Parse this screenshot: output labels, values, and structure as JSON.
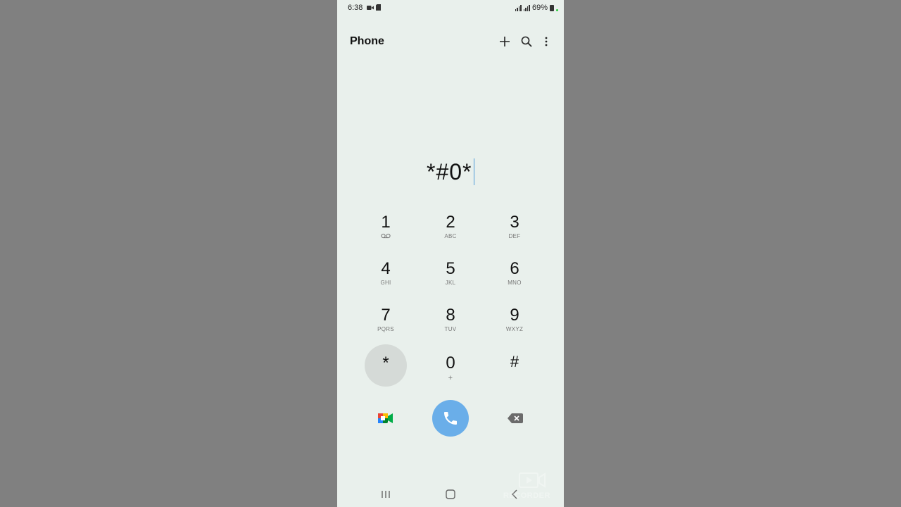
{
  "status_bar": {
    "time": "6:38",
    "battery": "69%",
    "icons": [
      "video-camera-icon",
      "sd-card-icon",
      "signal-icon",
      "signal-icon",
      "battery-icon"
    ]
  },
  "header": {
    "title": "Phone",
    "icons": [
      "plus-icon",
      "search-icon",
      "more-vert-icon"
    ]
  },
  "dialer": {
    "number": "*#0*"
  },
  "keypad": [
    {
      "digit": "1",
      "letters": "voicemail-icon"
    },
    {
      "digit": "2",
      "letters": "ABC"
    },
    {
      "digit": "3",
      "letters": "DEF"
    },
    {
      "digit": "4",
      "letters": "GHI"
    },
    {
      "digit": "5",
      "letters": "JKL"
    },
    {
      "digit": "6",
      "letters": "MNO"
    },
    {
      "digit": "7",
      "letters": "PQRS"
    },
    {
      "digit": "8",
      "letters": "TUV"
    },
    {
      "digit": "9",
      "letters": "WXYZ"
    },
    {
      "digit": "*",
      "letters": ""
    },
    {
      "digit": "0",
      "letters": "+"
    },
    {
      "digit": "#",
      "letters": ""
    }
  ],
  "actions": {
    "left": "google-meet-icon",
    "center": "phone-icon",
    "right": "backspace-icon"
  },
  "nav": [
    "recents-icon",
    "home-icon",
    "back-icon"
  ],
  "watermark": {
    "text": "RECORDER"
  },
  "colors": {
    "background": "#e9f0ec",
    "call_button": "#6aaee9",
    "cursor": "#4f9bd8",
    "pressed_key": "#d5dad7"
  }
}
